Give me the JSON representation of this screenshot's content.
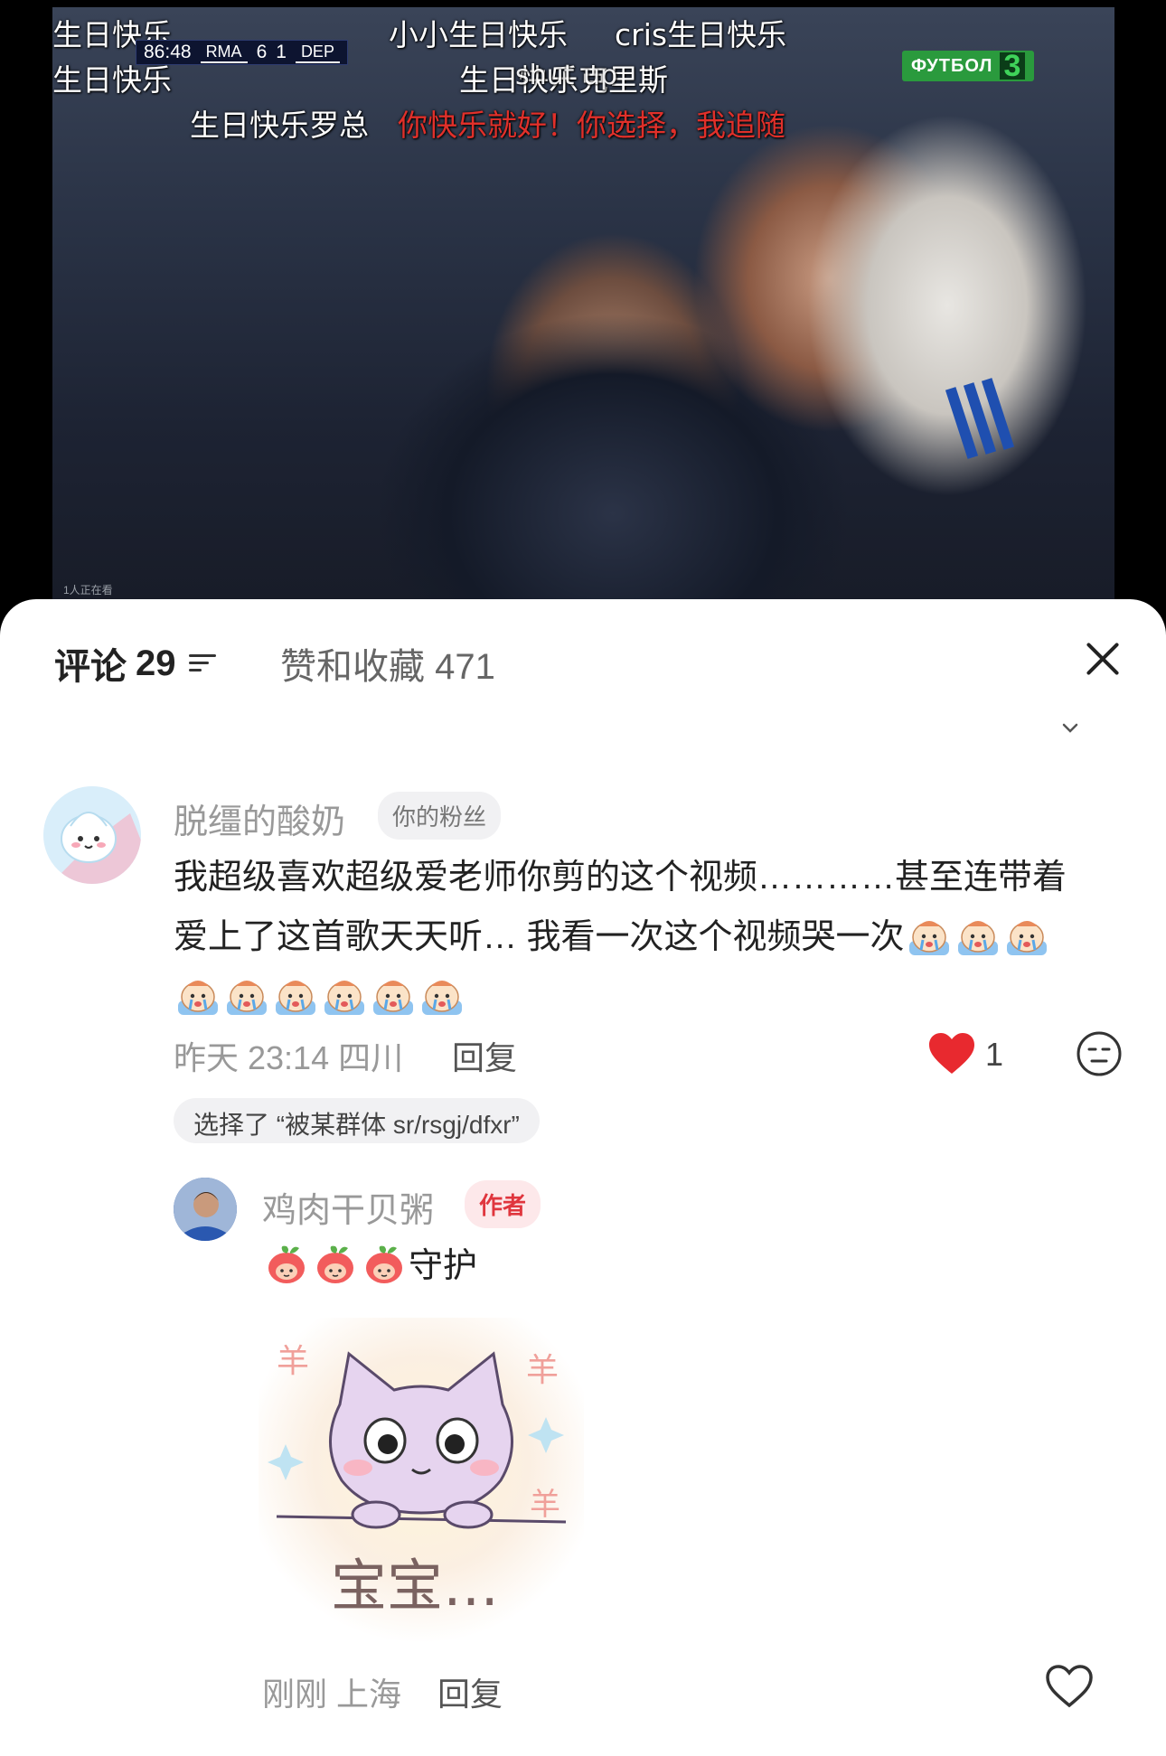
{
  "video": {
    "danmaku": [
      {
        "text": "生日快乐",
        "red": false
      },
      {
        "text": "小小生日快乐",
        "red": false
      },
      {
        "text": "cris生日快乐",
        "red": false
      },
      {
        "text": "生日快乐",
        "red": false
      },
      {
        "text": "生日快乐克里斯",
        "red": false
      },
      {
        "text": "生日快乐罗总",
        "red": false
      },
      {
        "text": "你快乐就好！你选择，我追随",
        "red": true
      }
    ],
    "overlay_text": "shut up",
    "scoreboard": {
      "time": "86:48",
      "home": "RMA",
      "home_score": "6",
      "away_score": "1",
      "away": "DEP"
    },
    "channel": {
      "name": "ФУТБОЛ",
      "number": "3"
    },
    "viewers": "1人正在看"
  },
  "sheet": {
    "comments_tab": {
      "label": "评论",
      "count": "29"
    },
    "likes_tab": {
      "label": "赞和收藏",
      "count": "471"
    }
  },
  "comments": [
    {
      "username": "脱缰的酸奶",
      "badge": "你的粉丝",
      "text_line1": "我超级喜欢超级爱老师你剪的这个视频…………甚至连带着",
      "text_line2": "爱上了这首歌天天听… 我看一次这个视频哭一次",
      "time": "昨天 23:14 四川",
      "reply_label": "回复",
      "likes": "1",
      "selected_pill": "选择了 “被某群体 sr/rsgj/dfxr”"
    },
    {
      "username": "鸡肉干贝粥",
      "badge": "作者",
      "text": "守护",
      "sticker_text": "宝宝…",
      "time": "刚刚 上海",
      "reply_label": "回复"
    }
  ],
  "colors": {
    "accent_red": "#e8292f",
    "author_badge_bg": "#fde8ea",
    "fan_badge_bg": "#f1f1f3"
  }
}
